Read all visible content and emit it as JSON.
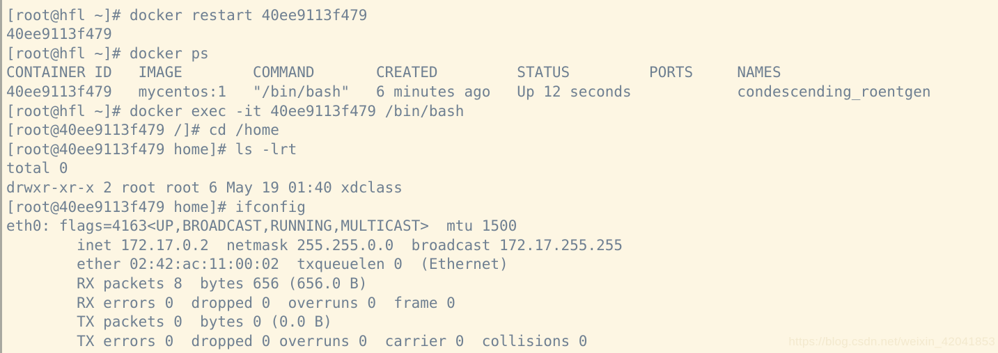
{
  "terminal": {
    "colors": {
      "background": "#fdf6e3",
      "foreground": "#6e7f91",
      "border": "#a8a8a0",
      "watermark": "#f3e9ce"
    },
    "prompts": {
      "host": "[root@hfl ~]#",
      "container_root": "[root@40ee9113f479 /]#",
      "container_home": "[root@40ee9113f479 home]#"
    },
    "container": {
      "id": "40ee9113f479",
      "image": "mycentos:1",
      "command": "\"/bin/bash\"",
      "created": "6 minutes ago",
      "status": "Up 12 seconds",
      "ports": "",
      "name": "condescending_roentgen"
    },
    "network": {
      "interface": "eth0",
      "flags": "flags=4163<UP,BROADCAST,RUNNING,MULTICAST>",
      "mtu": "mtu 1500",
      "inet": "172.17.0.2",
      "netmask": "255.255.0.0",
      "broadcast": "172.17.255.255",
      "ether": "02:42:ac:11:00:02",
      "txqueuelen": "0",
      "link_type": "(Ethernet)",
      "rx_packets": "8",
      "rx_bytes": "656 (656.0 B)",
      "tx_packets": "0",
      "tx_bytes": "0 (0.0 B)"
    },
    "lines": [
      "",
      "[root@hfl ~]# docker restart 40ee9113f479",
      "40ee9113f479",
      "[root@hfl ~]# docker ps",
      "CONTAINER ID   IMAGE        COMMAND       CREATED         STATUS         PORTS     NAMES",
      "40ee9113f479   mycentos:1   \"/bin/bash\"   6 minutes ago   Up 12 seconds            condescending_roentgen",
      "[root@hfl ~]# docker exec -it 40ee9113f479 /bin/bash",
      "[root@40ee9113f479 /]# cd /home",
      "[root@40ee9113f479 home]# ls -lrt",
      "total 0",
      "drwxr-xr-x 2 root root 6 May 19 01:40 xdclass",
      "[root@40ee9113f479 home]# ifconfig",
      "eth0: flags=4163<UP,BROADCAST,RUNNING,MULTICAST>  mtu 1500",
      "        inet 172.17.0.2  netmask 255.255.0.0  broadcast 172.17.255.255",
      "        ether 02:42:ac:11:00:02  txqueuelen 0  (Ethernet)",
      "        RX packets 8  bytes 656 (656.0 B)",
      "        RX errors 0  dropped 0  overruns 0  frame 0",
      "        TX packets 0  bytes 0 (0.0 B)",
      "        TX errors 0  dropped 0 overruns 0  carrier 0  collisions 0"
    ]
  },
  "watermark": {
    "text": "https://blog.csdn.net/weixin_42041853"
  }
}
